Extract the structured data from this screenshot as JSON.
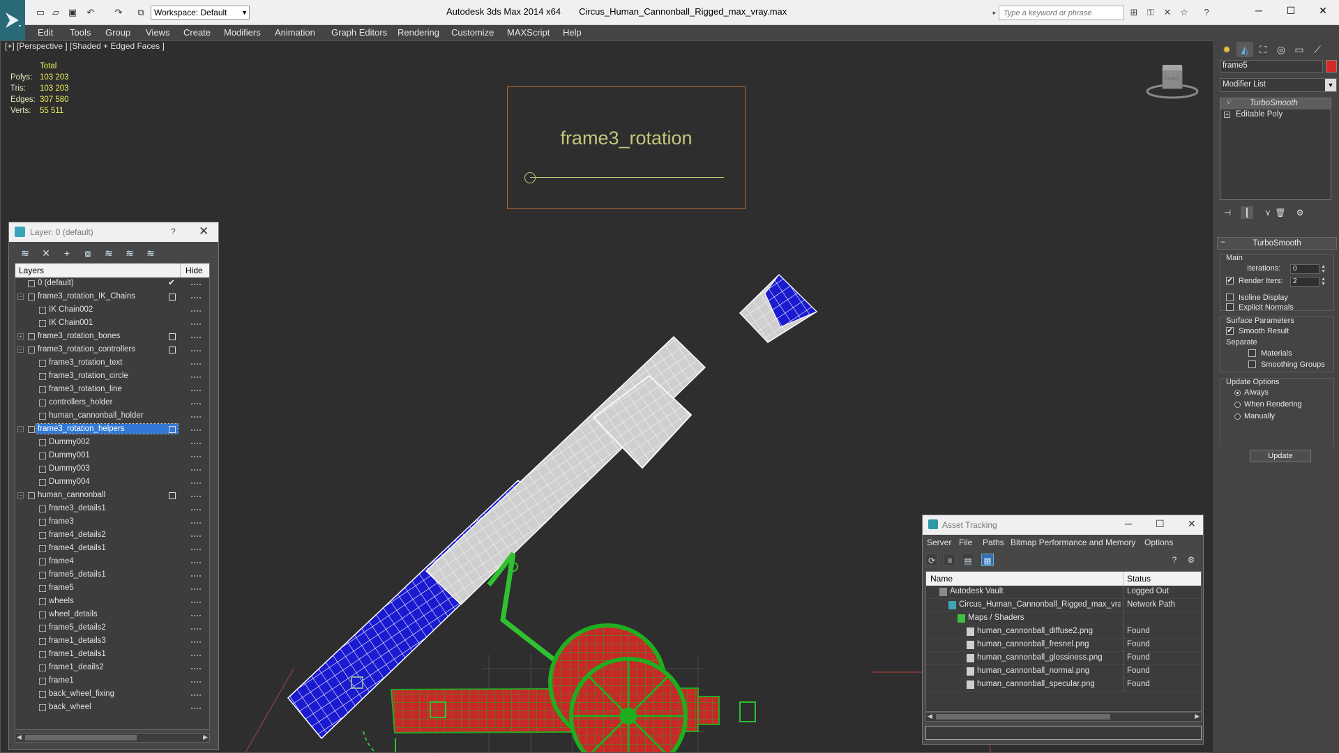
{
  "titlebar": {
    "workspace": "Workspace: Default",
    "app_name": "Autodesk 3ds Max  2014 x64",
    "file_name": "Circus_Human_Cannonball_Rigged_max_vray.max",
    "search_placeholder": "Type a keyword or phrase"
  },
  "menu": [
    "Edit",
    "Tools",
    "Group",
    "Views",
    "Create",
    "Modifiers",
    "Animation",
    "Graph Editors",
    "Rendering",
    "Customize",
    "MAXScript",
    "Help"
  ],
  "viewport": {
    "label": "[+] [Perspective ] [Shaded + Edged Faces ]",
    "stats": {
      "total_label": "Total",
      "rows": [
        {
          "label": "Polys:",
          "value": "103 203"
        },
        {
          "label": "Tris:",
          "value": "103 203"
        },
        {
          "label": "Edges:",
          "value": "307 580"
        },
        {
          "label": "Verts:",
          "value": "55 511"
        }
      ]
    },
    "frame_label": "frame3_rotation",
    "viewcube_label": "FRONT"
  },
  "layer_dialog": {
    "title": "Layer: 0 (default)",
    "help": "?",
    "col_layers": "Layers",
    "col_hide": "Hide",
    "layers": [
      {
        "name": "0 (default)",
        "depth": 0,
        "exp": "",
        "current": true
      },
      {
        "name": "frame3_rotation_IK_Chains",
        "depth": 0,
        "exp": "−",
        "box": true
      },
      {
        "name": "IK Chain002",
        "depth": 1
      },
      {
        "name": "IK Chain001",
        "depth": 1
      },
      {
        "name": "frame3_rotation_bones",
        "depth": 0,
        "exp": "+",
        "box": true
      },
      {
        "name": "frame3_rotation_controllers",
        "depth": 0,
        "exp": "−",
        "box": true
      },
      {
        "name": "frame3_rotation_text",
        "depth": 1
      },
      {
        "name": "frame3_rotation_circle",
        "depth": 1
      },
      {
        "name": "frame3_rotation_line",
        "depth": 1
      },
      {
        "name": "controllers_holder",
        "depth": 1
      },
      {
        "name": "human_cannonball_holder",
        "depth": 1
      },
      {
        "name": "frame3_rotation_helpers",
        "depth": 0,
        "exp": "−",
        "box": true,
        "selected": true
      },
      {
        "name": "Dummy002",
        "depth": 1
      },
      {
        "name": "Dummy001",
        "depth": 1
      },
      {
        "name": "Dummy003",
        "depth": 1
      },
      {
        "name": "Dummy004",
        "depth": 1
      },
      {
        "name": "human_cannonball",
        "depth": 0,
        "exp": "−",
        "box": true
      },
      {
        "name": "frame3_details1",
        "depth": 1
      },
      {
        "name": "frame3",
        "depth": 1
      },
      {
        "name": "frame4_details2",
        "depth": 1
      },
      {
        "name": "frame4_details1",
        "depth": 1
      },
      {
        "name": "frame4",
        "depth": 1
      },
      {
        "name": "frame5_details1",
        "depth": 1
      },
      {
        "name": "frame5",
        "depth": 1
      },
      {
        "name": "wheels",
        "depth": 1
      },
      {
        "name": "wheel_details",
        "depth": 1
      },
      {
        "name": "frame5_details2",
        "depth": 1
      },
      {
        "name": "frame1_details3",
        "depth": 1
      },
      {
        "name": "frame1_details1",
        "depth": 1
      },
      {
        "name": "frame1_deails2",
        "depth": 1
      },
      {
        "name": "frame1",
        "depth": 1
      },
      {
        "name": "back_wheel_fixing",
        "depth": 1
      },
      {
        "name": "back_wheel",
        "depth": 1
      }
    ]
  },
  "asset_dialog": {
    "title": "Asset Tracking",
    "menu": [
      "Server",
      "File",
      "Paths",
      "Bitmap Performance and Memory",
      "Options"
    ],
    "col_name": "Name",
    "col_status": "Status",
    "rows": [
      {
        "name": "Autodesk Vault",
        "indent": 1,
        "status": "Logged Out",
        "icon": "vault-icon"
      },
      {
        "name": "Circus_Human_Cannonball_Rigged_max_vray.max",
        "indent": 2,
        "status": "Network Path",
        "icon": "max-file-icon"
      },
      {
        "name": "Maps / Shaders",
        "indent": 3,
        "status": "",
        "icon": "maps-icon"
      },
      {
        "name": "human_cannonball_diffuse2.png",
        "indent": 4,
        "status": "Found",
        "icon": "bitmap-icon"
      },
      {
        "name": "human_cannonball_fresnel.png",
        "indent": 4,
        "status": "Found",
        "icon": "bitmap-icon"
      },
      {
        "name": "human_cannonball_glossiness.png",
        "indent": 4,
        "status": "Found",
        "icon": "bitmap-icon"
      },
      {
        "name": "human_cannonball_normal.png",
        "indent": 4,
        "status": "Found",
        "icon": "bitmap-icon"
      },
      {
        "name": "human_cannonball_specular.png",
        "indent": 4,
        "status": "Found",
        "icon": "bitmap-icon"
      }
    ]
  },
  "command_panel": {
    "object_name": "frame5",
    "object_color": "#d42a2a",
    "modifier_list": "Modifier List",
    "stack": [
      {
        "name": "TurboSmooth",
        "selected": true
      },
      {
        "name": "Editable Poly",
        "selected": false
      }
    ],
    "rollout_title": "TurboSmooth",
    "main_label": "Main",
    "iterations_label": "Iterations:",
    "iterations": "0",
    "render_iters_label": "Render Iters:",
    "render_iters": "2",
    "isoline_label": "Isoline Display",
    "explicit_normals_label": "Explicit Normals",
    "surface_params_label": "Surface Parameters",
    "smooth_result_label": "Smooth Result",
    "separate_label": "Separate",
    "materials_label": "Materials",
    "smoothing_groups_label": "Smoothing Groups",
    "update_options_label": "Update Options",
    "always_label": "Always",
    "when_rendering_label": "When Rendering",
    "manually_label": "Manually",
    "update_button": "Update"
  }
}
